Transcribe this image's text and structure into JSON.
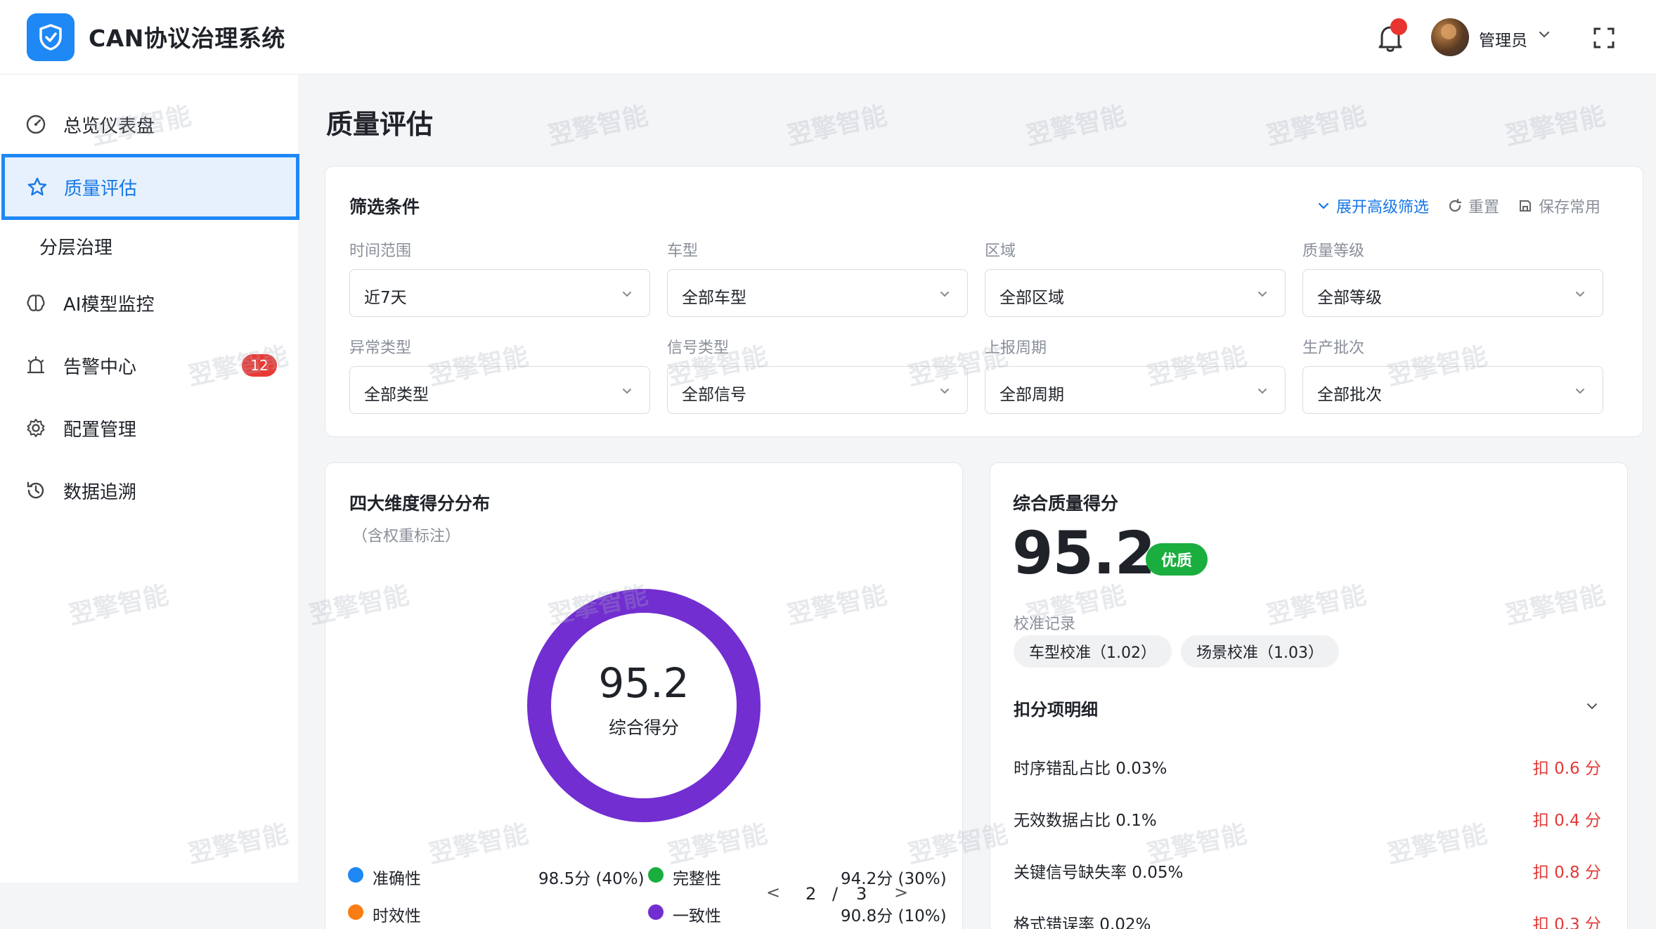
{
  "app": {
    "title": "CAN协议治理系统"
  },
  "header": {
    "user_name": "管理员",
    "icons": [
      "bell-icon",
      "chevron-down-icon",
      "fullscreen-icon"
    ]
  },
  "sidebar": {
    "items": [
      {
        "label": "总览仪表盘",
        "icon": "dashboard-icon"
      },
      {
        "label": "质量评估",
        "icon": "star-icon",
        "active": true
      },
      {
        "label": "分层治理"
      },
      {
        "label": "AI模型监控",
        "icon": "brain-icon"
      },
      {
        "label": "告警中心",
        "icon": "alarm-icon",
        "badge": "12"
      },
      {
        "label": "配置管理",
        "icon": "gear-icon"
      },
      {
        "label": "数据追溯",
        "icon": "history-icon"
      }
    ]
  },
  "page": {
    "title": "质量评估"
  },
  "filter": {
    "title": "筛选条件",
    "actions": {
      "expand": "展开高级筛选",
      "reset": "重置",
      "save": "保存常用"
    },
    "fields": [
      {
        "label": "时间范围",
        "value": "近7天"
      },
      {
        "label": "车型",
        "value": "全部车型"
      },
      {
        "label": "区域",
        "value": "全部区域"
      },
      {
        "label": "质量等级",
        "value": "全部等级"
      },
      {
        "label": "异常类型",
        "value": "全部类型"
      },
      {
        "label": "信号类型",
        "value": "全部信号"
      },
      {
        "label": "上报周期",
        "value": "全部周期"
      },
      {
        "label": "生产批次",
        "value": "全部批次"
      }
    ]
  },
  "distribution": {
    "title": "四大维度得分分布",
    "note": "（含权重标注）",
    "center_value": "95.2",
    "center_label": "综合得分",
    "ring_color": "#722ed1",
    "legend": [
      {
        "name": "准确性",
        "value": "98.5分 (40%)",
        "color": "#1e88f5"
      },
      {
        "name": "完整性",
        "value": "94.2分 (30%)",
        "color": "#1aae3f"
      },
      {
        "name": "时效性",
        "value": "",
        "color": "#fa7d14"
      },
      {
        "name": "一致性",
        "value": "90.8分 (10%)",
        "color": "#722ed1"
      }
    ],
    "pager": {
      "prev": "<",
      "current": "2",
      "sep": "/",
      "total": "3",
      "next": ">"
    }
  },
  "score": {
    "title": "综合质量得分",
    "value": "95.2",
    "grade": "优质",
    "grade_color": "#1aae3f",
    "calibration_label": "校准记录",
    "calibrations": [
      "车型校准（1.02）",
      "场景校准（1.03）"
    ],
    "deduction_title": "扣分项明细",
    "deductions": [
      {
        "item": "时序错乱占比 0.03%",
        "value": "扣 0.6 分"
      },
      {
        "item": "无效数据占比 0.1%",
        "value": "扣 0.4 分"
      },
      {
        "item": "关键信号缺失率 0.05%",
        "value": "扣 0.8 分"
      },
      {
        "item": "格式错误率 0.02%",
        "value": "扣 0.3 分"
      }
    ]
  },
  "watermark": "翌擎智能",
  "colors": {
    "primary": "#1e88f5",
    "danger": "#e23a36",
    "success": "#1aae3f"
  }
}
